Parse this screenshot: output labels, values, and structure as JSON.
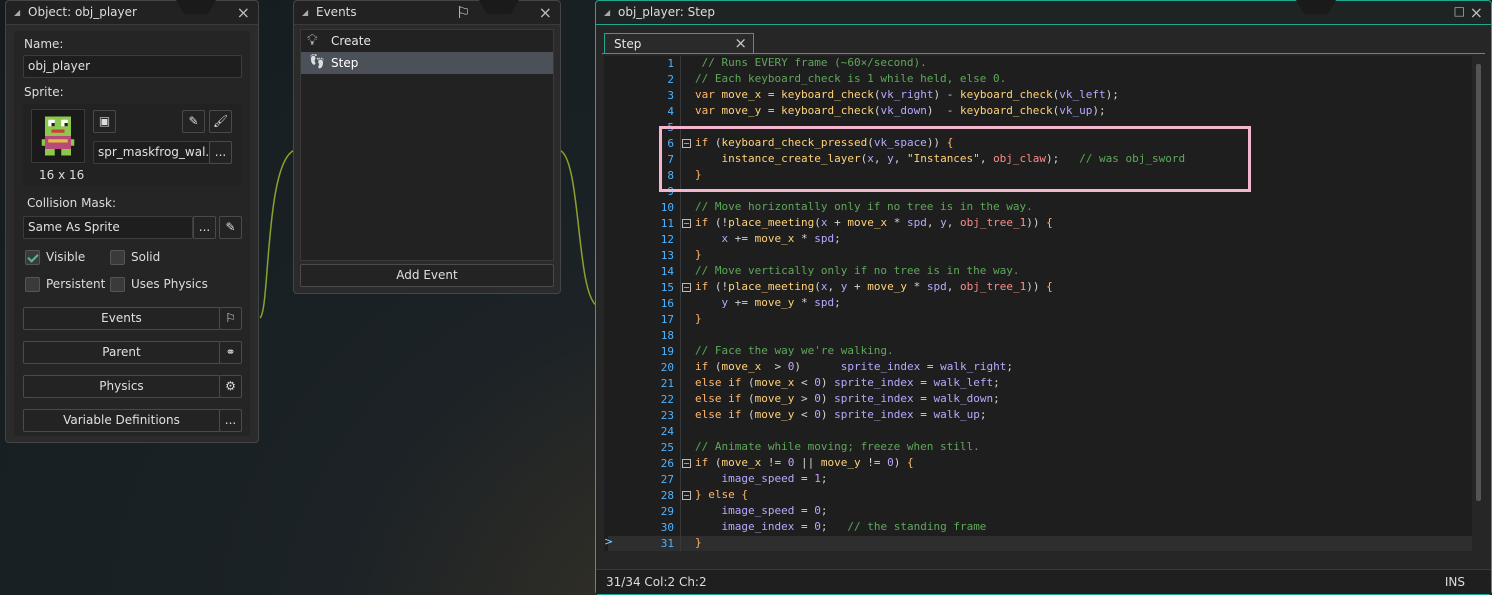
{
  "object_panel": {
    "title": "Object: obj_player",
    "name_label": "Name:",
    "name_value": "obj_player",
    "sprite_label": "Sprite:",
    "sprite_name": "spr_maskfrog_wal...",
    "sprite_size": "16 x 16",
    "mask_label": "Collision Mask:",
    "mask_value": "Same As Sprite",
    "visible_label": "Visible",
    "solid_label": "Solid",
    "persistent_label": "Persistent",
    "physics_check_label": "Uses Physics",
    "events_btn": "Events",
    "parent_btn": "Parent",
    "physics_btn": "Physics",
    "vardef_btn": "Variable Definitions",
    "ellipsis": "...",
    "visible_checked": true,
    "solid_checked": false,
    "persistent_checked": false,
    "uses_physics_checked": false
  },
  "events_panel": {
    "title": "Events",
    "items": [
      "Create",
      "Step"
    ],
    "add_label": "Add Event"
  },
  "code_window": {
    "title": "obj_player: Step",
    "tab": "Step",
    "status_left": "31/34 Col:2 Ch:2",
    "status_right": "INS",
    "line_numbers": [
      "1",
      "2",
      "3",
      "4",
      "5",
      "6",
      "7",
      "8",
      "9",
      "10",
      "11",
      "12",
      "13",
      "14",
      "15",
      "16",
      "17",
      "18",
      "19",
      "20",
      "21",
      "22",
      "23",
      "24",
      "25",
      "26",
      "27",
      "28",
      "29",
      "30",
      "31"
    ],
    "highlight_color": "#f4b6cf"
  }
}
